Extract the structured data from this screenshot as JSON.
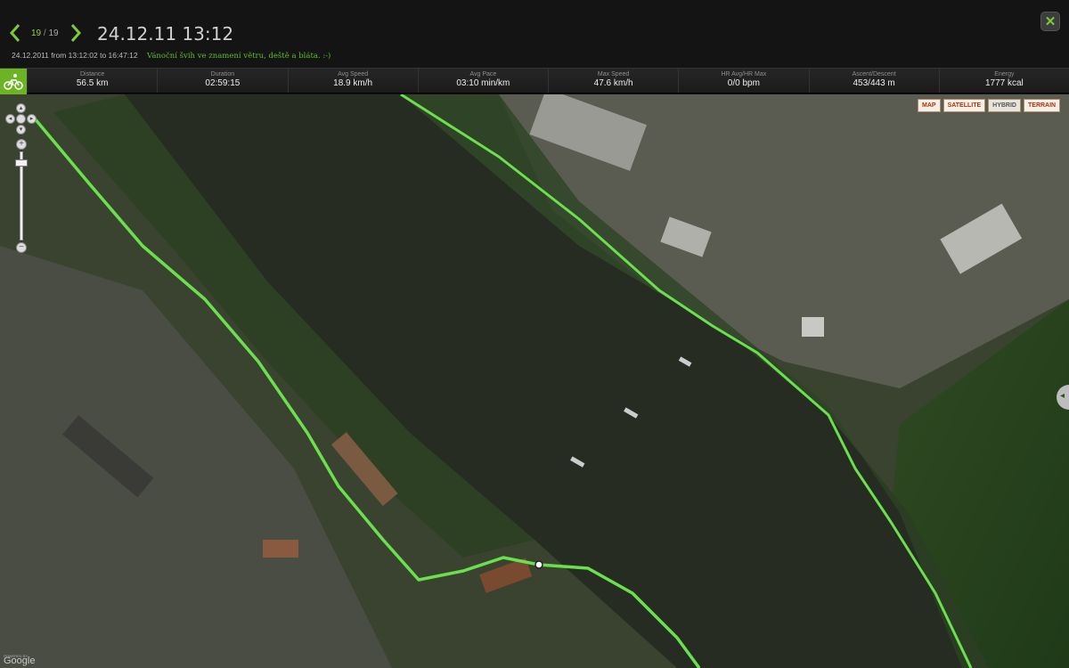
{
  "header": {
    "counter_current": "19",
    "counter_sep": "/",
    "counter_total": "19",
    "title": "24.12.11 13:12",
    "date_range": "24.12.2011 from 13:12:02 to 16:47:12",
    "description": "Vánoční švih ve znamení větru, deště a bláta. :-)"
  },
  "stats": [
    {
      "label": "Distance",
      "value": "56.5 km"
    },
    {
      "label": "Duration",
      "value": "02:59:15"
    },
    {
      "label": "Avg Speed",
      "value": "18.9 km/h"
    },
    {
      "label": "Avg Pace",
      "value": "03:10 min/km"
    },
    {
      "label": "Max Speed",
      "value": "47.6 km/h"
    },
    {
      "label": "HR Avg/HR Max",
      "value": "0/0 bpm"
    },
    {
      "label": "Ascent/Descent",
      "value": "453/443 m"
    },
    {
      "label": "Energy",
      "value": "1777 kcal"
    }
  ],
  "map": {
    "types": [
      "MAP",
      "SATELLITE",
      "HYBRID",
      "TERRAIN"
    ],
    "active_type": "HYBRID",
    "logo": "Google",
    "logo_small": "POWERED BY",
    "route_color": "#69e04c",
    "water_color": "#262c22",
    "zoom_level_fraction": 0.1
  },
  "icons": {
    "prev": "chevron-left-icon",
    "next": "chevron-right-icon",
    "close": "close-icon",
    "sport": "cycling-icon"
  }
}
